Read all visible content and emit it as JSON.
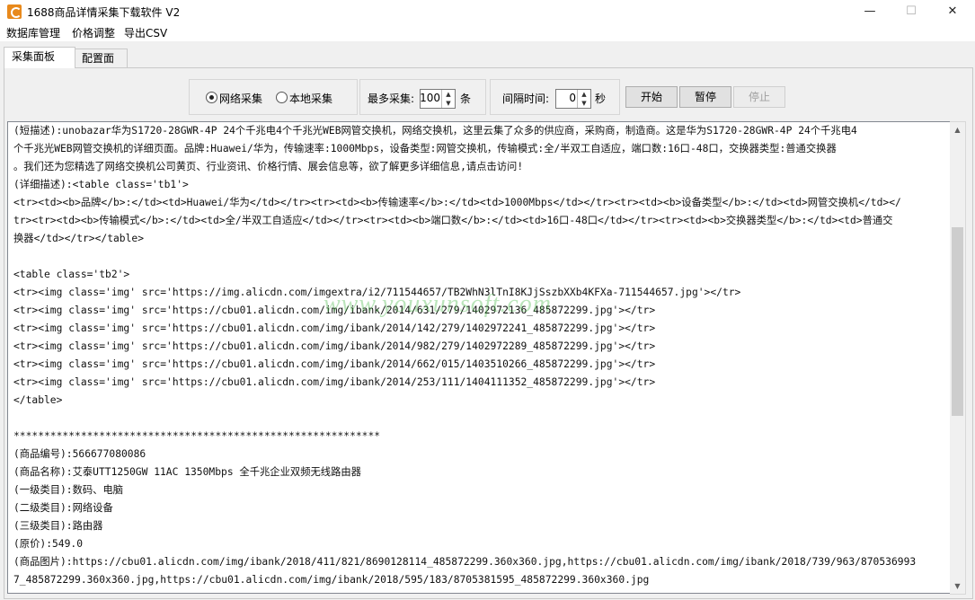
{
  "window": {
    "title": "1688商品详情采集下载软件 V2",
    "minimize": "—",
    "maximize": "☐",
    "close": "✕"
  },
  "menu": [
    "数据库管理",
    "价格调整",
    "导出CSV"
  ],
  "tabs": [
    "采集面板",
    "配置面板"
  ],
  "controls": {
    "radio_network": "网络采集",
    "radio_local": "本地采集",
    "max_label": "最多采集:",
    "max_value": "100",
    "max_unit": "条",
    "interval_label": "间隔时间:",
    "interval_value": "0",
    "interval_unit": "秒",
    "start": "开始",
    "pause": "暂停",
    "stop": "停止"
  },
  "watermark": "www.youxunsoft.com",
  "log_lines": [
    "(短描述):unobazar华为S1720-28GWR-4P 24个千兆电4个千兆光WEB网管交换机，网络交换机，这里云集了众多的供应商，采购商，制造商。这是华为S1720-28GWR-4P 24个千兆电4",
    "个千兆光WEB网管交换机的详细页面。品牌:Huawei/华为，传输速率:1000Mbps，设备类型:网管交换机，传输模式:全/半双工自适应，端口数:16口-48口，交换器类型:普通交换器",
    "。我们还为您精选了网络交换机公司黄页、行业资讯、价格行情、展会信息等，欲了解更多详细信息,请点击访问!",
    "(详细描述):<table  class='tb1'>",
    "<tr><td><b>品牌</b>:</td><td>Huawei/华为</td></tr><tr><td><b>传输速率</b>:</td><td>1000Mbps</td></tr><tr><td><b>设备类型</b>:</td><td>网管交换机</td></",
    "tr><tr><td><b>传输模式</b>:</td><td>全/半双工自适应</td></tr><tr><td><b>端口数</b>:</td><td>16口-48口</td></tr><tr><td><b>交换器类型</b>:</td><td>普通交",
    "换器</td></tr></table>",
    "",
    "<table  class='tb2'>",
    "<tr><img class='img'  src='https://img.alicdn.com/imgextra/i2/711544657/TB2WhN3lTnI8KJjSszbXXb4KFXa-711544657.jpg'></tr>",
    "<tr><img class='img'  src='https://cbu01.alicdn.com/img/ibank/2014/631/279/1402972136_485872299.jpg'></tr>",
    "<tr><img class='img'  src='https://cbu01.alicdn.com/img/ibank/2014/142/279/1402972241_485872299.jpg'></tr>",
    "<tr><img class='img'  src='https://cbu01.alicdn.com/img/ibank/2014/982/279/1402972289_485872299.jpg'></tr>",
    "<tr><img class='img'  src='https://cbu01.alicdn.com/img/ibank/2014/662/015/1403510266_485872299.jpg'></tr>",
    "<tr><img class='img'  src='https://cbu01.alicdn.com/img/ibank/2014/253/111/1404111352_485872299.jpg'></tr>",
    "</table>",
    "",
    "************************************************************",
    "(商品编号):566677080086",
    "(商品名称):艾泰UTT1250GW 11AC 1350Mbps 全千兆企业双频无线路由器",
    "(一级类目):数码、电脑",
    "(二级类目):网络设备",
    "(三级类目):路由器",
    "(原价):549.0",
    "(商品图片):https://cbu01.alicdn.com/img/ibank/2018/411/821/8690128114_485872299.360x360.jpg,https://cbu01.alicdn.com/img/ibank/2018/739/963/870536993",
    "7_485872299.360x360.jpg,https://cbu01.alicdn.com/img/ibank/2018/595/183/8705381595_485872299.360x360.jpg"
  ]
}
